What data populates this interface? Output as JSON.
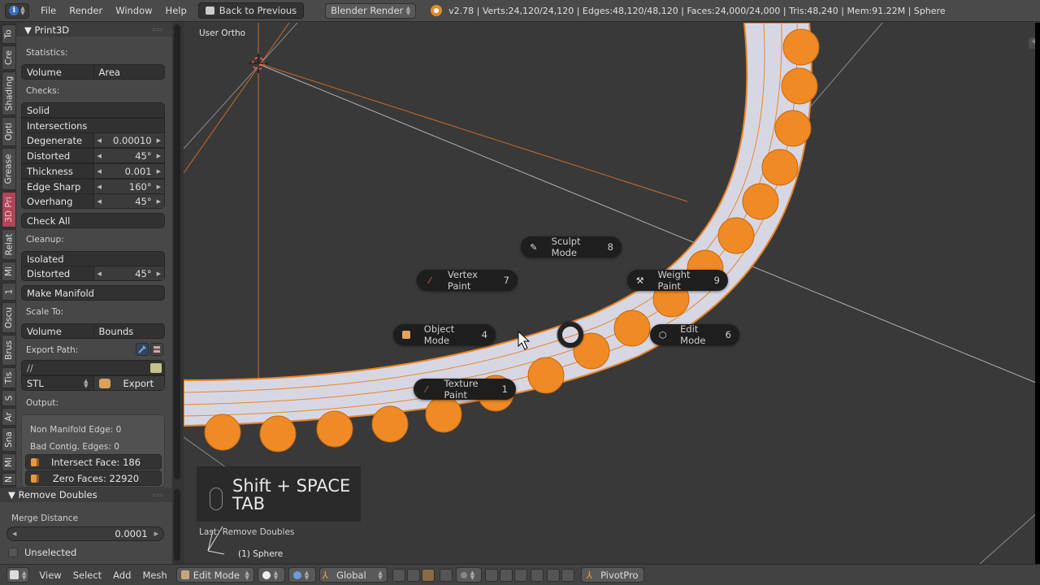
{
  "topbar": {
    "info_icon": "info-icon",
    "menus": [
      "File",
      "Render",
      "Window",
      "Help"
    ],
    "back_button": "Back to Previous",
    "render_engine": "Blender Render",
    "stats": "v2.78 | Verts:24,120/24,120 | Edges:48,120/48,120 | Faces:24,000/24,000 | Tris:48,240 | Mem:91.22M | Sphere"
  },
  "tool_tabs": [
    "To",
    "Cre",
    "Shading",
    "Opti",
    "Grease",
    "3D Pri",
    "Relat",
    "Mi",
    "1",
    "Oscu",
    "Brus",
    "Tis",
    "S",
    "Ar",
    "Sna",
    "Mi",
    "N"
  ],
  "active_tab": "3D Pri",
  "print3d": {
    "title": "Print3D",
    "statistics_label": "Statistics:",
    "statistics_buttons": [
      "Volume",
      "Area"
    ],
    "checks_label": "Checks:",
    "solid": "Solid",
    "intersections": "Intersections",
    "checks": [
      {
        "label": "Degenerate",
        "value": "0.00010"
      },
      {
        "label": "Distorted",
        "value": "45°"
      },
      {
        "label": "Thickness",
        "value": "0.001"
      },
      {
        "label": "Edge Sharp",
        "value": "160°"
      },
      {
        "label": "Overhang",
        "value": "45°"
      }
    ],
    "check_all": "Check All",
    "cleanup_label": "Cleanup:",
    "isolated": "Isolated",
    "cleanup_distorted": {
      "label": "Distorted",
      "value": "45°"
    },
    "make_manifold": "Make Manifold",
    "scale_to_label": "Scale To:",
    "scale_buttons": [
      "Volume",
      "Bounds"
    ],
    "export_path_label": "Export Path:",
    "export_path_value": "//",
    "export_format": "STL",
    "export_button": "Export",
    "output_label": "Output:",
    "output": {
      "non_manifold": "Non Manifold Edge: 0",
      "bad_contig": "Bad Contig. Edges: 0",
      "intersect_face": "Intersect Face: 186",
      "zero_faces": "Zero Faces: 22920"
    }
  },
  "remove_doubles": {
    "title": "Remove Doubles",
    "merge_distance_label": "Merge Distance",
    "merge_distance_value": "0.0001",
    "unselected_label": "Unselected",
    "unselected_checked": false
  },
  "viewport": {
    "view_label": "User Ortho",
    "last_operator": "Last: Remove Doubles",
    "object_label": "(1) Sphere",
    "shortcut_line1": "Shift + SPACE",
    "shortcut_line2": "TAB",
    "pie_menu": [
      {
        "label": "Sculpt Mode",
        "key": "8",
        "icon": "sculpt-icon"
      },
      {
        "label": "Vertex Paint",
        "key": "7",
        "icon": "vertex-paint-icon"
      },
      {
        "label": "Weight Paint",
        "key": "9",
        "icon": "weight-paint-icon"
      },
      {
        "label": "Object Mode",
        "key": "4",
        "icon": "object-mode-icon"
      },
      {
        "label": "Edit Mode",
        "key": "6",
        "icon": "edit-mode-icon"
      },
      {
        "label": "Texture Paint",
        "key": "1",
        "icon": "texture-paint-icon"
      }
    ],
    "colors": {
      "selection": "#f08a24",
      "mesh": "#d9d9e6",
      "background": "#393939"
    }
  },
  "bottombar": {
    "menus": [
      "View",
      "Select",
      "Add",
      "Mesh"
    ],
    "mode": "Edit Mode",
    "orientation": "Global",
    "pivot_addon": "PivotPro"
  }
}
